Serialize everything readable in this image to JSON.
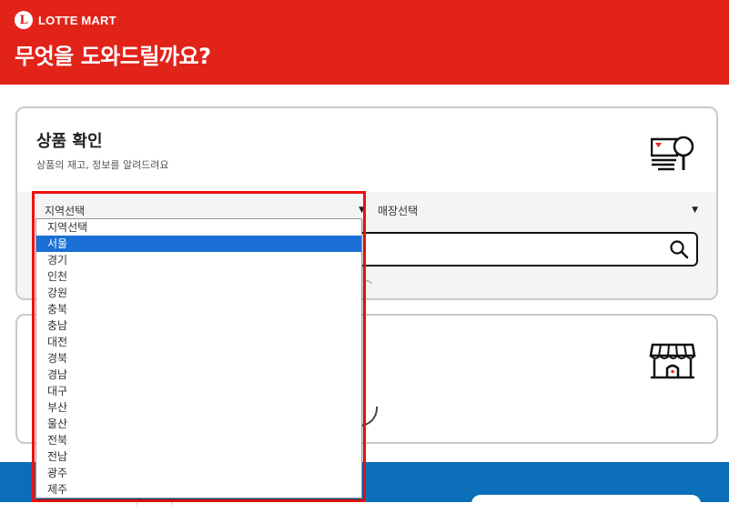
{
  "header": {
    "logo_mark": "L",
    "logo_text": "LOTTE MART",
    "headline": "무엇을 도와드릴까요?",
    "bg_color": "#e2231a"
  },
  "product_card": {
    "title": "상품 확인",
    "subtitle": "상품의 재고, 정보를 알려드려요",
    "icon": "product-search-icon"
  },
  "region_select": {
    "value": "지역선택",
    "options": [
      "지역선택",
      "서울",
      "경기",
      "인천",
      "강원",
      "충북",
      "충남",
      "대전",
      "경북",
      "경남",
      "대구",
      "부산",
      "울산",
      "전북",
      "전남",
      "광주",
      "제주"
    ],
    "highlighted_index": 1
  },
  "store_select": {
    "value": "매장선택"
  },
  "search": {
    "placeholder": "",
    "icon": "search-icon"
  },
  "store_card": {
    "icon": "store-icon"
  },
  "colors": {
    "accent": "#e2231a",
    "blue_band": "#0a6fb8",
    "selected_option": "#1a6fd6",
    "annotation_box": "#ee1111"
  }
}
